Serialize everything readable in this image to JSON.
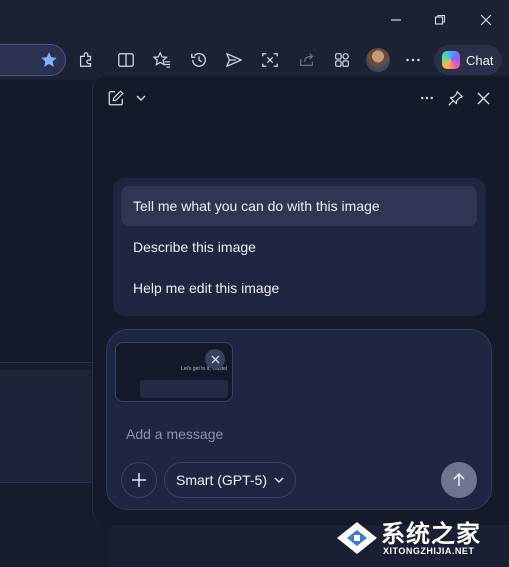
{
  "window": {
    "minimize_icon": "minimize-icon",
    "restore_icon": "restore-icon",
    "close_icon": "close-icon"
  },
  "toolbar": {
    "chat_label": "Chat",
    "icons": [
      "favorite-star-icon",
      "extensions-icon",
      "split-screen-icon",
      "favorites-icon",
      "history-icon",
      "send-icon",
      "screenshot-icon",
      "share-icon",
      "workspaces-icon",
      "more-icon"
    ]
  },
  "panel": {
    "suggestions": [
      "Tell me what you can do with this image",
      "Describe this image",
      "Help me edit this image"
    ],
    "attachment_caption": "Let's get to it, Vlastel",
    "input_placeholder": "Add a message",
    "model_label": "Smart (GPT-5)"
  },
  "watermark": {
    "chinese": "系统之家",
    "url": "XITONGZHIJIA.NET"
  },
  "colors": {
    "background": "#1a1f33",
    "panel": "#151a2b",
    "accent_star": "#7fb2ff"
  }
}
